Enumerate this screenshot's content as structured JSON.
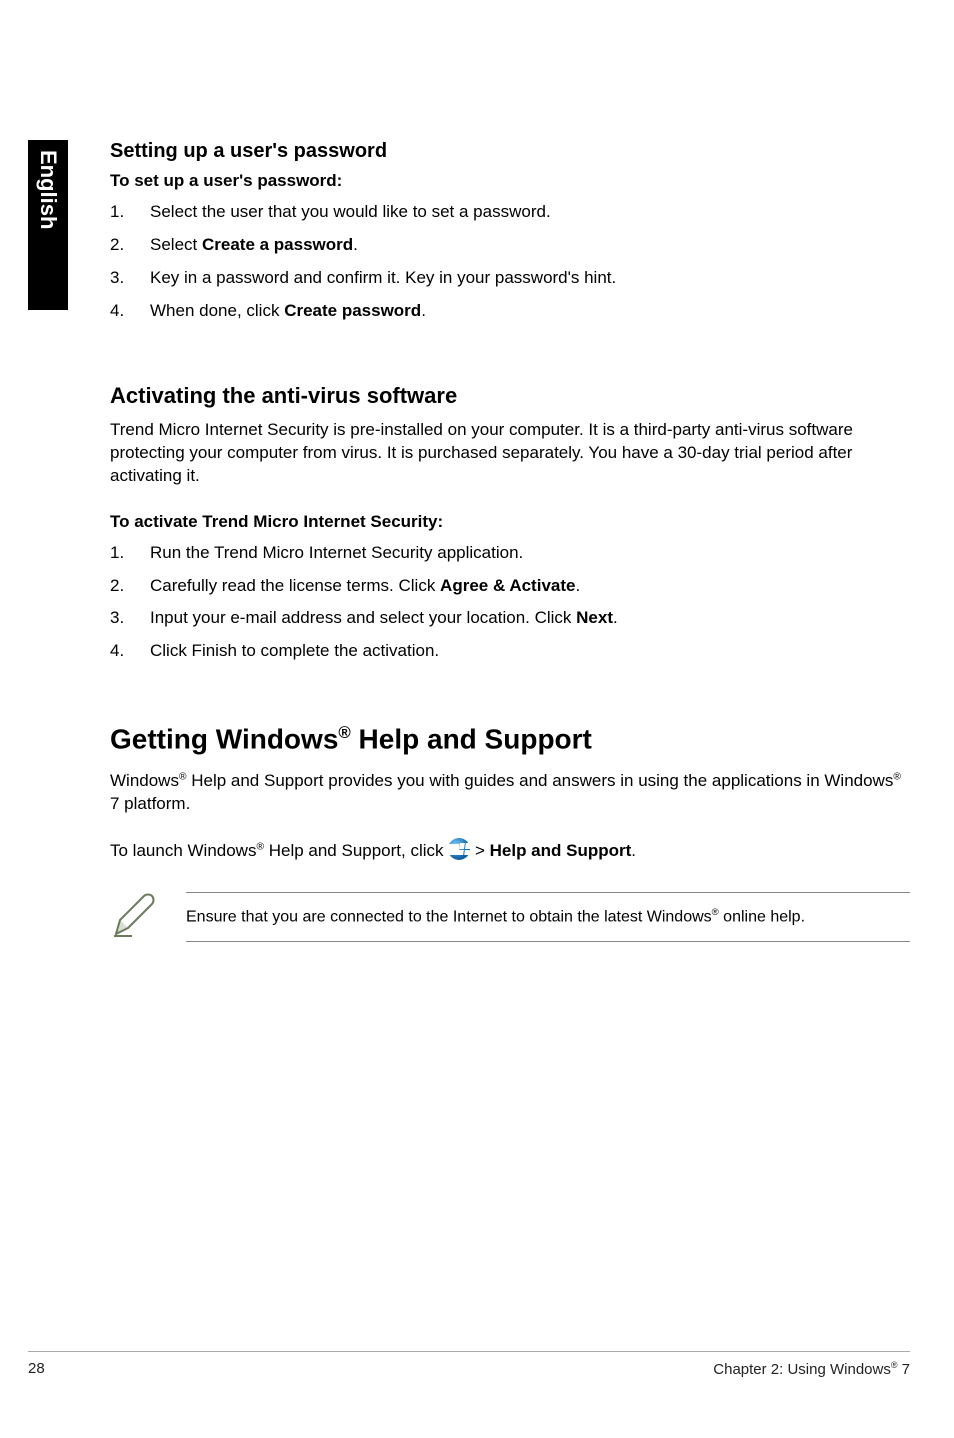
{
  "side_tab": "English",
  "section1": {
    "heading": "Setting up a user's password",
    "sub": "To set up a user's password:",
    "steps": [
      "Select the user that you would like to set a password.",
      "Select <b>Create a password</b>.",
      "Key in a password and confirm it. Key in your password's hint.",
      "When done, click <b>Create password</b>."
    ]
  },
  "section2": {
    "heading": "Activating the anti-virus software",
    "intro": "Trend Micro Internet Security is pre-installed on your computer. It is a third-party anti-virus software protecting your computer from virus. It is purchased separately. You have a 30-day trial period after activating it.",
    "sub": "To activate Trend Micro Internet Security:",
    "steps": [
      "Run the Trend Micro Internet Security application.",
      "Carefully read the license terms. Click <b>Agree & Activate</b>.",
      "Input your e-mail address and select your location. Click <b>Next</b>.",
      "Click Finish to complete the activation."
    ]
  },
  "section3": {
    "heading_pre": "Getting Windows",
    "heading_post": " Help and Support",
    "para1_pre": "Windows",
    "para1_mid": " Help and Support provides you with guides and answers in using the applications in Windows",
    "para1_post": " 7 platform.",
    "para2_pre": "To launch Windows",
    "para2_mid": " Help and Support, click ",
    "para2_post1": " > ",
    "para2_bold": "Help and Support",
    "para2_end": ".",
    "note_pre": "Ensure that you are connected to the Internet to obtain the latest Windows",
    "note_post": " online help."
  },
  "footer": {
    "page": "28",
    "chapter_pre": "Chapter 2: Using Windows",
    "chapter_post": " 7"
  },
  "reg": "®"
}
